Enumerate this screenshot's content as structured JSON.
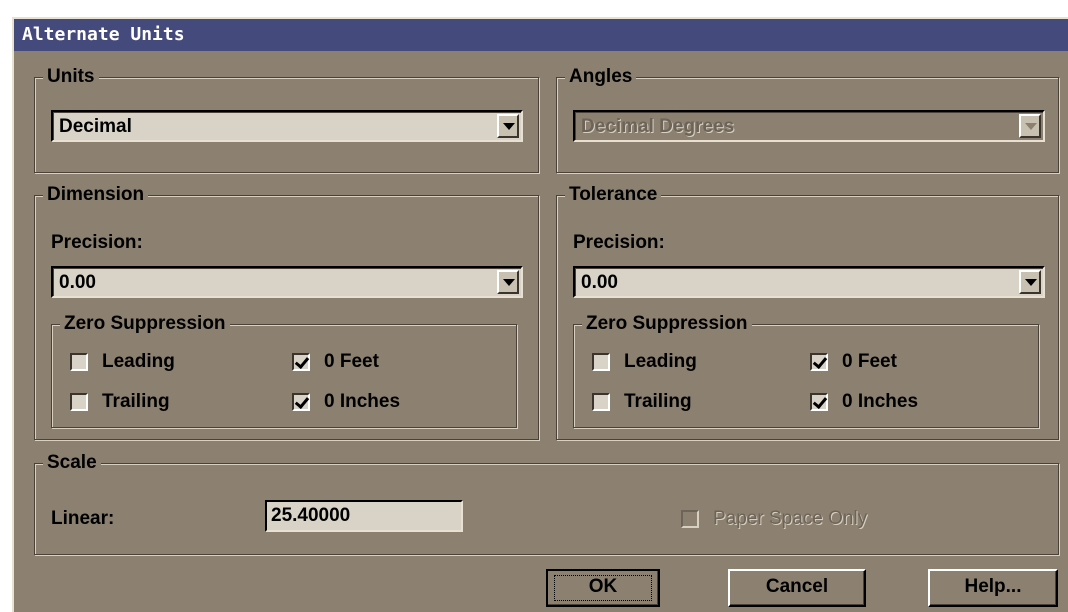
{
  "dialog": {
    "title": "Alternate Units"
  },
  "units": {
    "legend": "Units",
    "value": "Decimal"
  },
  "angles": {
    "legend": "Angles",
    "value": "Decimal Degrees",
    "enabled": false
  },
  "dimension": {
    "legend": "Dimension",
    "precision_label": "Precision:",
    "precision_value": "0.00",
    "zero_suppression": {
      "legend": "Zero Suppression",
      "leading": {
        "label": "Leading",
        "checked": false
      },
      "trailing": {
        "label": "Trailing",
        "checked": false
      },
      "feet": {
        "label": "0 Feet",
        "checked": true
      },
      "inches": {
        "label": "0 Inches",
        "checked": true
      }
    }
  },
  "tolerance": {
    "legend": "Tolerance",
    "precision_label": "Precision:",
    "precision_value": "0.00",
    "zero_suppression": {
      "legend": "Zero Suppression",
      "leading": {
        "label": "Leading",
        "checked": false
      },
      "trailing": {
        "label": "Trailing",
        "checked": false
      },
      "feet": {
        "label": "0 Feet",
        "checked": true
      },
      "inches": {
        "label": "0 Inches",
        "checked": true
      }
    }
  },
  "scale": {
    "legend": "Scale",
    "linear_label": "Linear:",
    "linear_value": "25.40000",
    "paper_space_only": {
      "label": "Paper Space Only",
      "checked": false,
      "enabled": false
    }
  },
  "buttons": {
    "ok": "OK",
    "cancel": "Cancel",
    "help": "Help..."
  },
  "colors": {
    "title_bar": "#454a7c",
    "dialog_bg": "#8c8070",
    "field_bg": "#d8d3c6"
  }
}
